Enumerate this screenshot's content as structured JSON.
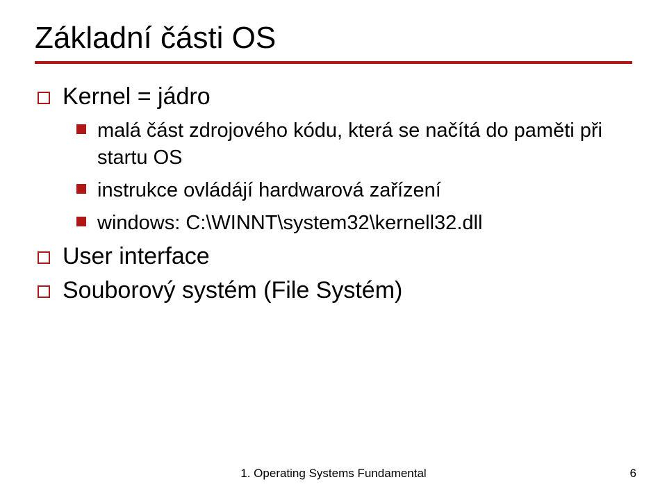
{
  "slide": {
    "title": "Základní části OS",
    "items": [
      {
        "level": 1,
        "text": "Kernel = jádro"
      },
      {
        "level": 2,
        "text": "malá část zdrojového kódu, která se načítá do paměti při startu OS"
      },
      {
        "level": 2,
        "text": "instrukce ovládájí hardwarová zařízení"
      },
      {
        "level": 2,
        "text": "windows: C:\\WINNT\\system32\\kernell32.dll"
      },
      {
        "level": 1,
        "text": "User interface"
      },
      {
        "level": 1,
        "text": "Souborový systém (File Systém)"
      }
    ],
    "footer": "1. Operating Systems Fundamental",
    "page": "6"
  }
}
